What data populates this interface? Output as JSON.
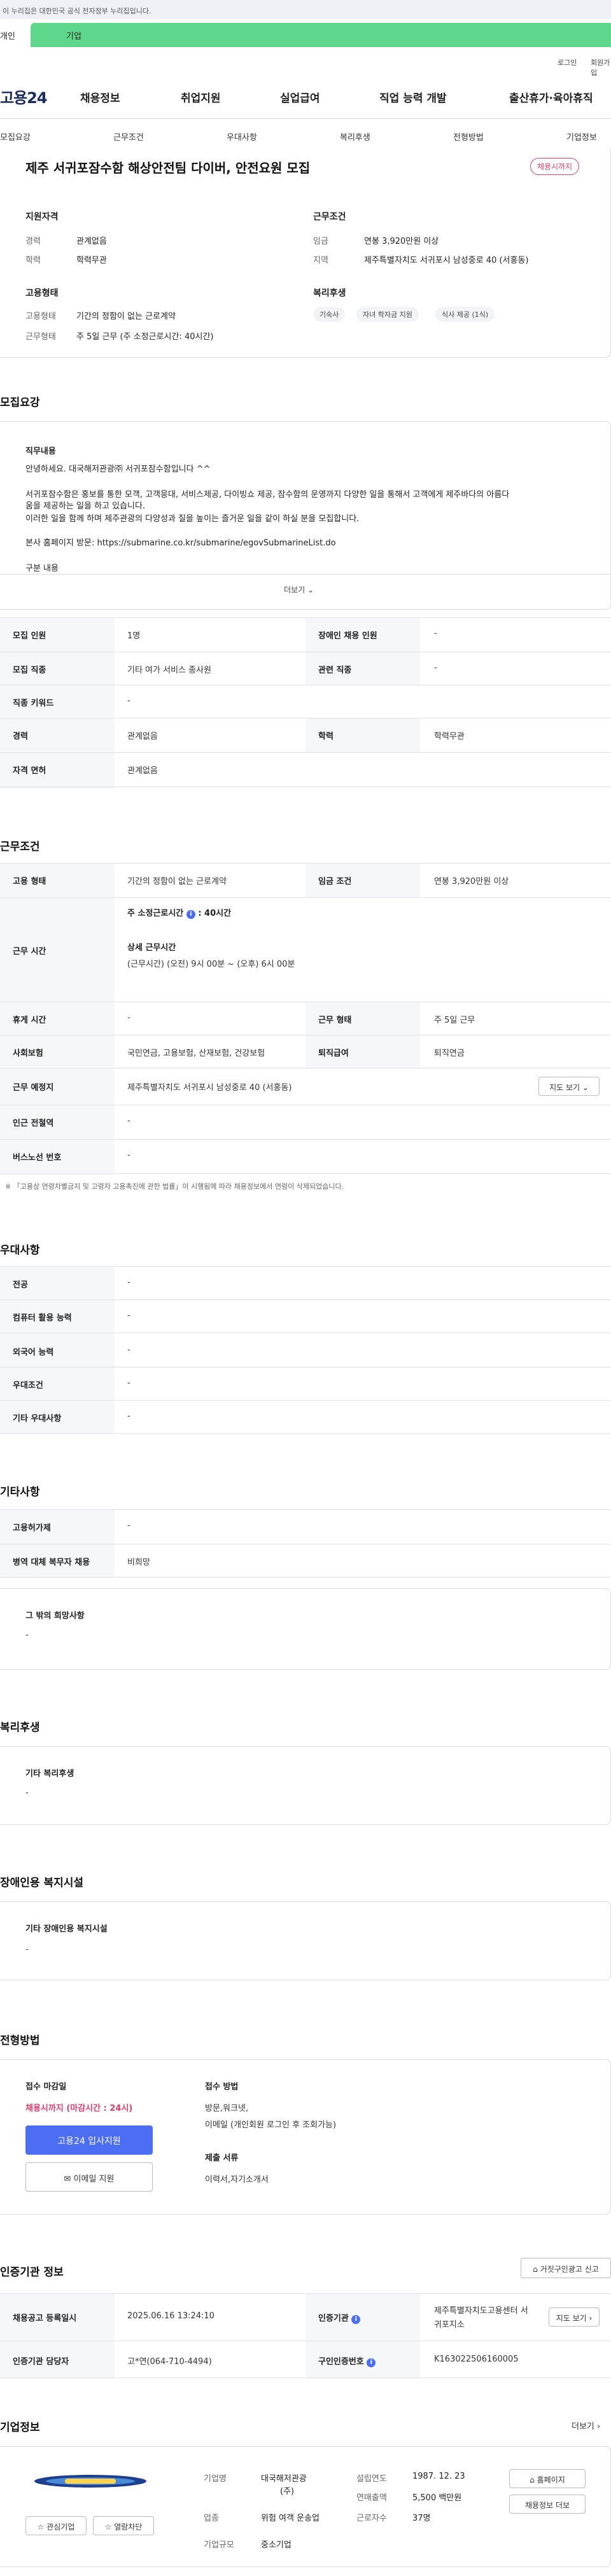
{
  "gov_banner": "이 누리집은 대한민국 공식 전자정부 누리집입니다.",
  "tabs": {
    "tab1": "개인",
    "tab2": "기업"
  },
  "util": {
    "login": "로그인",
    "join": "회원가입"
  },
  "logo": "고용24",
  "gnb": [
    "채용정보",
    "취업지원",
    "실업급여",
    "직업 능력 개발",
    "출산휴가·육아휴직"
  ],
  "subnav": [
    "모집요강",
    "근무조건",
    "우대사항",
    "복리후생",
    "전형방법",
    "기업정보"
  ],
  "job": {
    "title": "제주 서귀포잠수함 해상안전팀 다이버, 안전요원 모집",
    "status": "채용시까지",
    "qual_head": "지원자격",
    "cond_head": "근무조건",
    "career_k": "경력",
    "career_v": "관계없음",
    "edu_k": "학력",
    "edu_v": "학력무관",
    "wage_k": "임금",
    "wage_v": "연봉 3,920만원 이상",
    "area_k": "지역",
    "area_v": "제주특별자치도 서귀포시 남성중로 40 (서홍동)",
    "emp_head": "고용형태",
    "wel_head": "복리후생",
    "empt_k": "고용형태",
    "empt_v": "기간의 정함이 없는 근로계약",
    "work_k": "근무형태",
    "work_v": "주 5일 근무 (주 소정근로시간: 40시간)",
    "chips": [
      "기숙사",
      "자녀 학자금 지원",
      "식사 제공 (1식)"
    ]
  },
  "recruit": {
    "head": "모집요강",
    "duty_head": "직무내용",
    "lines": [
      "안녕하세요. 대국해저관광㈜ 서귀포잠수함입니다 ^^",
      "서귀포잠수함은 홍보를 통한 모객, 고객응대, 서비스제공, 다이빙쇼 제공, 잠수함의 운영까지 다양한 일을 통해서 고객에게 제주바다의 아름다",
      "움을 제공하는 일을 하고 있습니다.",
      "이러한 일을 함께 하며 제주관광의 다양성과 질을 높이는 즐거운 일을 같이 하실 분을 모집합니다.",
      "본사 홈페이지 방문: https://submarine.co.kr/submarine/egovSubmarineList.do",
      "구분 내용"
    ],
    "more": "더보기",
    "rows": [
      {
        "k1": "모집 인원",
        "v1": "1명",
        "k2": "장애인 채용 인원",
        "v2": "-"
      },
      {
        "k1": "모집 직종",
        "v1": "기타 여가 서비스 종사원",
        "k2": "관련 직종",
        "v2": "-"
      },
      {
        "k1": "직종 키워드",
        "v1": "-"
      },
      {
        "k1": "경력",
        "v1": "관계없음",
        "k2": "학력",
        "v2": "학력무관"
      },
      {
        "k1": "자격 면허",
        "v1": "관계없음"
      }
    ]
  },
  "cond": {
    "head": "근무조건",
    "empt_k": "고용 형태",
    "empt_v": "기간의 정함이 없는 근로계약",
    "wage_k": "임금 조건",
    "wage_v": "연봉 3,920만원 이상",
    "time_k": "근무 시간",
    "time_line1": "주 소정근로시간",
    "time_line1b": ": 40시간",
    "detail_head": "상세 근무시간",
    "detail_v": "(근무시간) (오전) 9시 00분 ~ (오후) 6시 00분",
    "rest_k": "휴게 시간",
    "rest_v": "-",
    "form_k": "근무 형태",
    "form_v": "주 5일 근무",
    "ins_k": "사회보험",
    "ins_v": "국민연금, 고용보험, 산재보험, 건강보험",
    "sev_k": "퇴직급여",
    "sev_v": "퇴직연금",
    "place_k": "근무 예정지",
    "place_v": "제주특별자치도 서귀포시 남성중로 40 (서홍동)",
    "map_btn": "지도 보기",
    "subway_k": "인근 전철역",
    "subway_v": "-",
    "bus_k": "버스노선 번호",
    "bus_v": "-",
    "note": "※ 「고용상 연령차별금지 및 고령자 고용촉진에 관한 법률」이 시행됨에 따라 채용정보에서 연령이 삭제되었습니다."
  },
  "pref": {
    "head": "우대사항",
    "rows": [
      {
        "k": "전공",
        "v": "-"
      },
      {
        "k": "컴퓨터 활용 능력",
        "v": "-"
      },
      {
        "k": "외국어 능력",
        "v": "-"
      },
      {
        "k": "우대조건",
        "v": "-"
      },
      {
        "k": "기타 우대사항",
        "v": "-"
      }
    ]
  },
  "etc": {
    "head": "기타사항",
    "rows": [
      {
        "k": "고용허가제",
        "v": "-"
      },
      {
        "k": "병역 대체 복무자 채용",
        "v": "비희망"
      }
    ],
    "other_head": "그 밖의 희망사항",
    "other_v": "-"
  },
  "welfare": {
    "head": "복리후생",
    "box_head": "기타 복리후생",
    "box_v": "-"
  },
  "disab": {
    "head": "장애인용 복지시설",
    "box_head": "기타 장애인용 복지시설",
    "box_v": "-"
  },
  "process": {
    "head": "전형방법",
    "deadline_head": "접수 마감일",
    "deadline_v": "채용시까지 (마감시간 : 24시)",
    "apply_btn": "고용24 입사지원",
    "email_btn": "이메일 지원",
    "method_head": "접수 방법",
    "method_v1": "방문,워크넷,",
    "method_v2": "이메일 (개인회원 로그인 후 조회가능)",
    "docs_head": "제출 서류",
    "docs_v": "이력서,자기소개서"
  },
  "cert": {
    "head": "인증기관 정보",
    "report_btn": "거짓구인광고 신고",
    "r1k1": "채용공고 등록일시",
    "r1v1": "2025.06.16 13:24:10",
    "r1k2": "인증기관",
    "r1v2a": "제주특별자치도고용센터 서",
    "r1v2b": "귀포지소",
    "map_btn": "지도 보기",
    "r2k1": "인증기관 담당자",
    "r2v1": "고*연(064-710-4494)",
    "r2k2": "구인인증번호",
    "r2v2": "K163022506160005"
  },
  "company": {
    "head": "기업정보",
    "more": "더보기",
    "logo_text": "대국해저관광",
    "k_name": "기업명",
    "v_name1": "대국해저관광",
    "v_name2": "(주)",
    "k_biz": "업종",
    "v_biz": "위험 여객 운송업",
    "k_size": "기업규모",
    "v_size": "중소기업",
    "k_est": "설립연도",
    "v_est": "1987. 12. 23",
    "k_sales": "연매출액",
    "v_sales": "5,500 백만원",
    "k_emp": "근로자수",
    "v_emp": "37명",
    "btn_interest": "관심기업",
    "btn_block": "열람차단",
    "btn_home": "홈페이지",
    "btn_jobs": "채용정보 더보"
  },
  "colors": {
    "accent": "#4c6ef5",
    "status": "#e23a6a",
    "tab_green": "#5fd78b"
  }
}
